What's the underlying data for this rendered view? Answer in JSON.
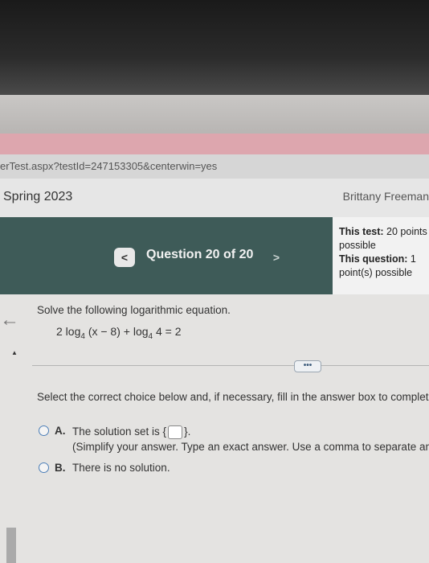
{
  "browser": {
    "url": "erTest.aspx?testId=247153305&centerwin=yes"
  },
  "header": {
    "course": "Spring 2023",
    "student": "Brittany Freeman"
  },
  "navigation": {
    "prev_label": "<",
    "question_label": "Question 20 of 20",
    "next_label": ">"
  },
  "score": {
    "test_label": "This test:",
    "test_value": "20 points possible",
    "question_label": "This question:",
    "question_value": "1 point(s) possible"
  },
  "question": {
    "prompt": "Solve the following logarithmic equation.",
    "equation": {
      "coef": "2 log",
      "base1": "4",
      "arg1": "(x − 8) + ",
      "log2": "log",
      "base2": "4",
      "arg2": "4 = 2"
    },
    "more_button": "•••",
    "instruction": "Select the correct choice below and, if necessary, fill in the answer box to complete"
  },
  "options": [
    {
      "letter": "A.",
      "text_before": "The solution set is {",
      "text_after": "}.",
      "hint": "(Simplify your answer. Type an exact answer. Use a comma to separate an"
    },
    {
      "letter": "B.",
      "text": "There is no solution."
    }
  ]
}
